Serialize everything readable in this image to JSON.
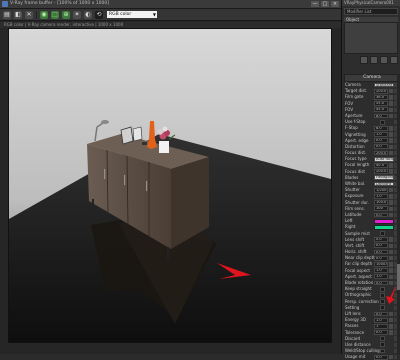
{
  "window": {
    "title": "V-Ray frame buffer - [100% of 1000 x 1000]",
    "status": "RGB color  |  V-Ray camera render, interactive  |  1000 x 1000",
    "controls": [
      "—",
      "□",
      "×"
    ]
  },
  "toolbar": {
    "buttons": [
      {
        "name": "save-image-icon",
        "glyph": "▤"
      },
      {
        "name": "load-image-icon",
        "glyph": "◧"
      },
      {
        "name": "clear-image-icon",
        "glyph": "✕"
      },
      {
        "name": "render-icon",
        "glyph": "◉"
      },
      {
        "name": "region-render-icon",
        "glyph": "⬚"
      },
      {
        "name": "track-mouse-icon",
        "glyph": "⊕"
      },
      {
        "name": "lens-effects-icon",
        "glyph": "✶"
      },
      {
        "name": "color-correction-icon",
        "glyph": "◐"
      },
      {
        "name": "history-icon",
        "glyph": "⟲"
      }
    ],
    "channel": "RGB color"
  },
  "render": {
    "background_top": "#d8d8d8",
    "background_bottom": "#5a5a5a",
    "floor": "#0e0e0e",
    "cabinet_front": "#5a4a3e",
    "cabinet_top": "#6e5f54",
    "annotation_color": "#e0141c"
  },
  "panel": {
    "title": "VRayPhysicalCamera001",
    "input_value": "Modifier List",
    "list_header": "Object",
    "camera_header": "Camera",
    "accent_red": "#e0141c",
    "rows": [
      {
        "label": "Camera",
        "type": "dd",
        "value": "Standard"
      },
      {
        "label": "Target dist.",
        "type": "val",
        "value": "200.0"
      },
      {
        "label": "Film gate",
        "type": "val",
        "value": "36.0"
      },
      {
        "label": "FOV",
        "type": "val",
        "value": "55.0"
      },
      {
        "label": "FOV",
        "type": "val",
        "value": "45.0"
      },
      {
        "label": "Aperture",
        "type": "val",
        "value": "8.0"
      },
      {
        "label": "Use f-Stop",
        "type": "check",
        "value": ""
      },
      {
        "label": "F-Stop",
        "type": "val",
        "value": "8.0"
      },
      {
        "label": "Vignetting",
        "type": "val",
        "value": "1.0"
      },
      {
        "label": "Apert. edge",
        "type": "val",
        "value": "0.0"
      },
      {
        "label": "Distortion",
        "type": "val",
        "value": "0.0"
      },
      {
        "label": "Focus dist.",
        "type": "val",
        "value": "200.0"
      },
      {
        "label": "Focus type",
        "type": "dd",
        "value": "Auto focus"
      },
      {
        "label": "Focal length",
        "type": "val",
        "value": "40.0"
      },
      {
        "label": "Focus dist",
        "type": "val",
        "value": "200.0"
      },
      {
        "label": "Blades",
        "type": "dd",
        "value": "Hexagonal"
      },
      {
        "label": "White bal.",
        "type": "dd",
        "value": "Daylight"
      },
      {
        "label": "Shutter",
        "type": "val",
        "value": "1/200"
      },
      {
        "label": "Exposure",
        "type": "val",
        "value": "1.0"
      },
      {
        "label": "Shutter dur.",
        "type": "val",
        "value": "100.0"
      },
      {
        "label": "Film sens.",
        "type": "val",
        "value": "100"
      },
      {
        "label": "Latitude",
        "type": "val",
        "value": "0.0"
      },
      {
        "label": "Left",
        "type": "swatch",
        "value": "#e01fd0"
      },
      {
        "label": "Right",
        "type": "swatch",
        "value": "#11d58a"
      },
      {
        "label": "Sample mist",
        "type": "check",
        "value": ""
      },
      {
        "label": "Lens shift",
        "type": "val",
        "value": "0.0"
      },
      {
        "label": "Vert. shift",
        "type": "val",
        "value": "0.0"
      },
      {
        "label": "Horiz. shift",
        "type": "val",
        "value": "0.0"
      },
      {
        "label": "Near clip depth",
        "type": "val",
        "value": "0.0"
      },
      {
        "label": "Far clip depth",
        "type": "val",
        "value": "1000.0"
      },
      {
        "label": "Focal aspect",
        "type": "val",
        "value": "1.0"
      },
      {
        "label": "Apert. aspect",
        "type": "val",
        "value": "1.0"
      },
      {
        "label": "Blade rotation",
        "type": "val",
        "value": "0.0"
      },
      {
        "label": "Keep straight",
        "type": "check",
        "value": ""
      },
      {
        "label": "Orthographic",
        "type": "check",
        "value": ""
      },
      {
        "label": "Persp. correction",
        "type": "check",
        "value": ""
      },
      {
        "label": "Setting",
        "type": "check",
        "value": ""
      },
      {
        "label": "Lift lens",
        "type": "val",
        "value": "0.0"
      },
      {
        "label": "Energy 3D",
        "type": "val",
        "value": "1.0"
      },
      {
        "label": "Passes",
        "type": "val",
        "value": "1"
      },
      {
        "label": "Tolerance",
        "type": "val",
        "value": "0.0"
      },
      {
        "label": "Discard",
        "type": "check",
        "value": ""
      },
      {
        "label": "Use distance",
        "type": "check",
        "value": ""
      },
      {
        "label": "Weld/Stop culling",
        "type": "check",
        "value": ""
      },
      {
        "label": "Usage mit",
        "type": "val",
        "value": "0.0"
      }
    ]
  }
}
